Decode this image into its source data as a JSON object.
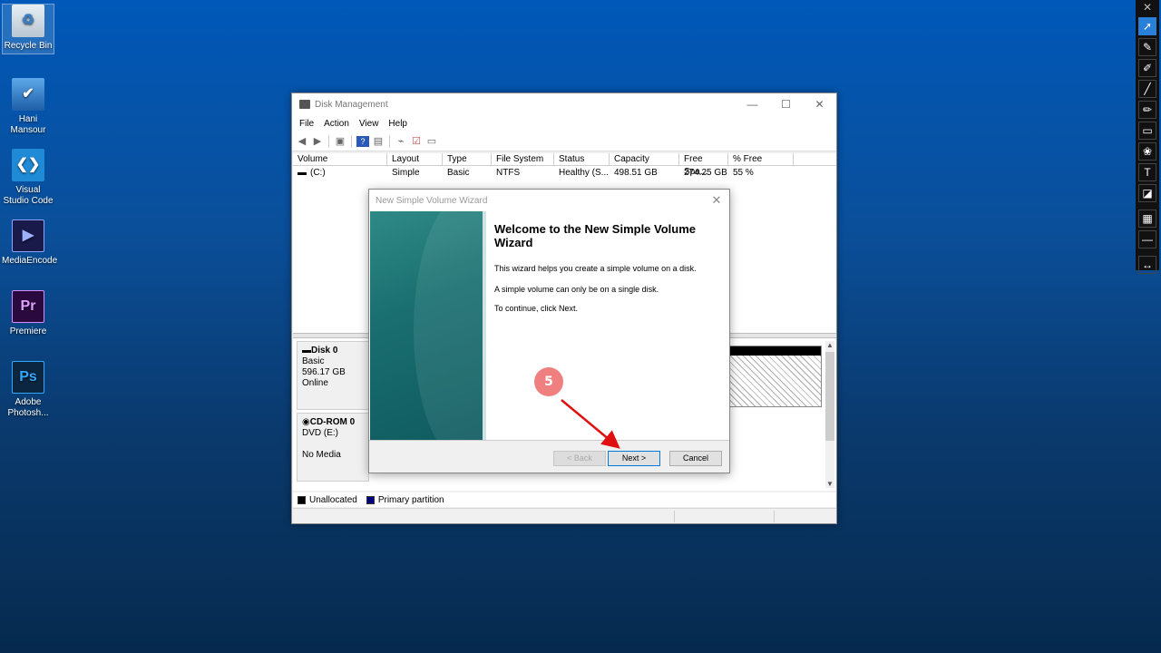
{
  "desktop": {
    "icons": [
      {
        "name": "recycle-bin-icon",
        "label": "Recycle Bin"
      },
      {
        "name": "user-folder-icon",
        "label": "Hani Mansour"
      },
      {
        "name": "vscode-icon",
        "label": "Visual Studio Code"
      },
      {
        "name": "media-encoder-icon",
        "label": "MediaEncode"
      },
      {
        "name": "premiere-icon",
        "label": "Premiere",
        "glyph": "Pr"
      },
      {
        "name": "photoshop-icon",
        "label": "Adobe Photosh...",
        "glyph": "Ps"
      }
    ]
  },
  "toolbar": {
    "close": "✕",
    "tools": [
      "cursor-icon",
      "pen-icon",
      "marker-icon",
      "line-icon",
      "brush-icon",
      "rectangle-icon",
      "palette-icon",
      "text-icon",
      "eraser-icon",
      "checker-icon",
      "minus-icon",
      "expand-icon"
    ],
    "text_tool": "T"
  },
  "disk_management": {
    "title": "Disk Management",
    "controls": {
      "minimize": "—",
      "maximize": "☐",
      "close": "✕"
    },
    "menu": [
      "File",
      "Action",
      "View",
      "Help"
    ],
    "columns": [
      "Volume",
      "Layout",
      "Type",
      "File System",
      "Status",
      "Capacity",
      "Free Spa...",
      "% Free"
    ],
    "rows": [
      {
        "volume": "(C:)",
        "layout": "Simple",
        "type": "Basic",
        "fs": "NTFS",
        "status": "Healthy (S...",
        "capacity": "498.51 GB",
        "free": "274.25 GB",
        "pct": "55 %"
      }
    ],
    "disks": [
      {
        "name": "Disk 0",
        "kind": "Basic",
        "size": "596.17 GB",
        "state": "Online"
      },
      {
        "name": "CD-ROM 0",
        "kind": "DVD (E:)",
        "size": "",
        "state": "No Media"
      }
    ],
    "legend": {
      "unallocated": "Unallocated",
      "primary": "Primary partition",
      "unallocated_color": "#000000",
      "primary_color": "#000080"
    }
  },
  "wizard": {
    "title": "New Simple Volume Wizard",
    "heading": "Welcome to the New Simple Volume Wizard",
    "line1": "This wizard helps you create a simple volume on a disk.",
    "line2": "A simple volume can only be on a single disk.",
    "line3": "To continue, click Next.",
    "back": "< Back",
    "next": "Next >",
    "cancel": "Cancel"
  },
  "annotation": {
    "step": "5",
    "color": "#e01010"
  }
}
